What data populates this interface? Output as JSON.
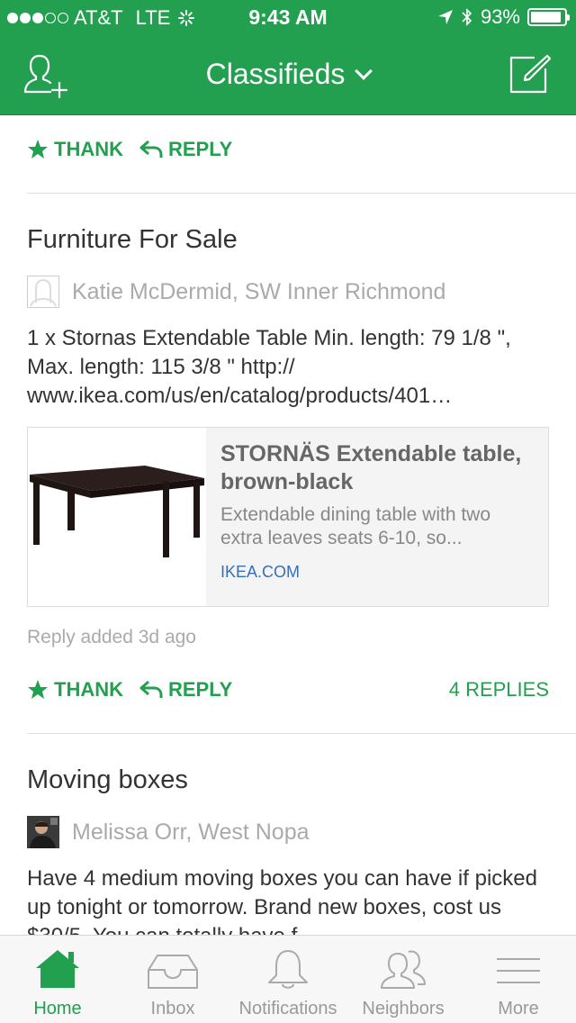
{
  "status_bar": {
    "carrier": "AT&T",
    "network": "LTE",
    "time": "9:43 AM",
    "battery_percent": "93%"
  },
  "nav": {
    "title": "Classifieds",
    "add_icon": "add-person-icon",
    "compose_icon": "compose-icon"
  },
  "colors": {
    "brand": "#23a04f",
    "link": "#3a6db8",
    "muted": "#aaaaaa"
  },
  "posts": [
    {
      "actions": {
        "thank": "THANK",
        "reply": "REPLY"
      }
    },
    {
      "title": "Furniture For Sale",
      "author": "Katie McDermid, SW Inner Richmond",
      "body": "1 x Stornas Extendable Table Min. length: 79 1/8 \", Max. length: 115 3/8 \" http:// www.ikea.com/us/en/catalog/products/401…",
      "link_preview": {
        "title": "STORNÄS Extendable table, brown-black",
        "description": "Extendable dining table with two extra leaves seats 6-10, so...",
        "domain": "IKEA.COM"
      },
      "meta": "Reply added 3d ago",
      "actions": {
        "thank": "THANK",
        "reply": "REPLY",
        "replies": "4 REPLIES"
      }
    },
    {
      "title": "Moving boxes",
      "author": "Melissa Orr, West Nopa",
      "body": "Have 4 medium moving boxes you can have if picked up tonight or tomorrow. Brand new boxes, cost us $30/5. You can totally have f"
    }
  ],
  "tabs": [
    {
      "label": "Home",
      "icon": "home-icon",
      "active": true
    },
    {
      "label": "Inbox",
      "icon": "inbox-icon",
      "active": false
    },
    {
      "label": "Notifications",
      "icon": "bell-icon",
      "active": false
    },
    {
      "label": "Neighbors",
      "icon": "neighbors-icon",
      "active": false
    },
    {
      "label": "More",
      "icon": "menu-icon",
      "active": false
    }
  ]
}
